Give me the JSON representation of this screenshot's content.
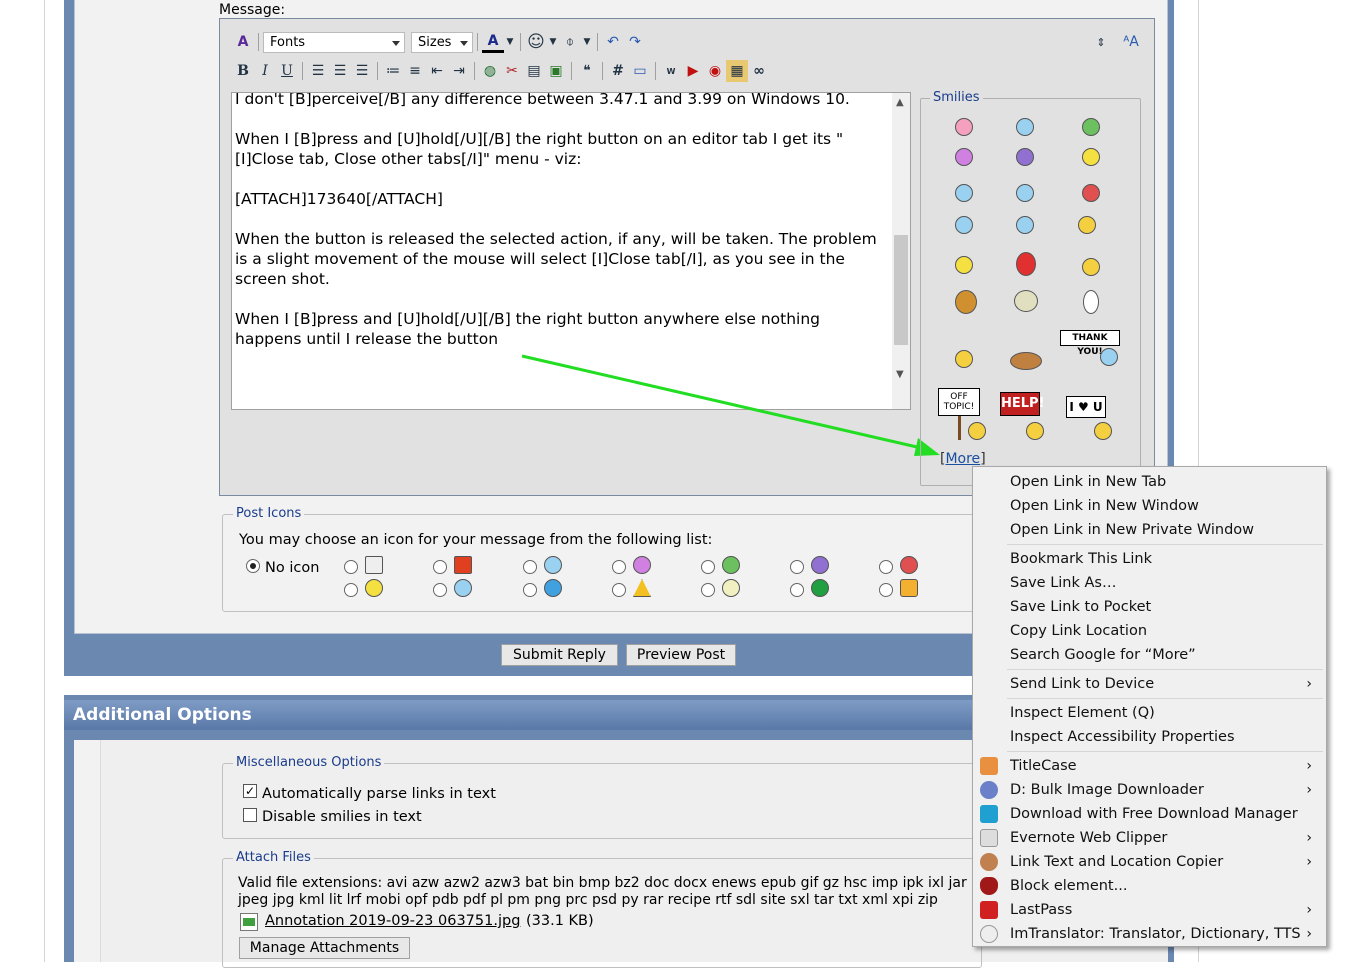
{
  "message_label": "Message:",
  "toolbar": {
    "fonts_label": "Fonts",
    "sizes_label": "Sizes"
  },
  "editor": {
    "text": "I don't [B]perceive[/B] any difference between 3.47.1 and 3.99 on Windows 10.\n\nWhen I [B]press and [U]hold[/U][/B] the right button on an editor tab I get its \"[I]Close tab, Close other tabs[/I]\" menu - viz:\n\n[ATTACH]173640[/ATTACH]\n\nWhen the button is released the selected action, if any, will be taken. The problem is a slight movement of the mouse will select [I]Close tab[/I], as you see in the screen shot.\n\nWhen I [B]press and [U]hold[/U][/B] the right button anywhere else nothing happens until I release the button"
  },
  "smilies": {
    "legend": "Smilies",
    "more_bracket_open": "[",
    "more_link": "More",
    "more_bracket_close": "]",
    "sign_off_topic": "OFF TOPIC!",
    "sign_help": "HELP!",
    "sign_thank_you": "THANK YOU!",
    "sign_i_love_u": "I ♥ U"
  },
  "post_icons": {
    "legend": "Post Icons",
    "instruction": "You may choose an icon for your message from the following list:",
    "no_icon_label": "No icon"
  },
  "buttons": {
    "submit": "Submit Reply",
    "preview": "Preview Post"
  },
  "additional": {
    "header": "Additional Options",
    "misc_legend": "Miscellaneous Options",
    "parse_links": "Automatically parse links in text",
    "disable_smilies": "Disable smilies in text",
    "attach_legend": "Attach Files",
    "extensions_line1": "Valid file extensions: avi azw azw2 azw3 bat bin bmp bz2 doc docx enews epub gif gz hsc imp ipk ixl jar",
    "extensions_line2": "jpeg jpg kml lit lrf mobi opf pdb pdf pl pm png prc psd py rar recipe rtf sdl site sxl tar txt xml xpi zip",
    "attachment_name": "Annotation 2019-09-23 063751.jpg",
    "attachment_size": "(33.1 KB)",
    "manage_button": "Manage Attachments"
  },
  "context_menu": {
    "items": [
      {
        "label": "Open Link in New Tab"
      },
      {
        "label": "Open Link in New Window"
      },
      {
        "label": "Open Link in New Private Window"
      },
      {
        "label": "Bookmark This Link"
      },
      {
        "label": "Save Link As…"
      },
      {
        "label": "Save Link to Pocket"
      },
      {
        "label": "Copy Link Location"
      },
      {
        "label": "Search Google for “More”"
      },
      {
        "label": "Send Link to Device"
      },
      {
        "label": "Inspect Element (Q)"
      },
      {
        "label": "Inspect Accessibility Properties"
      },
      {
        "label": "TitleCase"
      },
      {
        "label": "D: Bulk Image Downloader"
      },
      {
        "label": "Download with Free Download Manager"
      },
      {
        "label": "Evernote Web Clipper"
      },
      {
        "label": "Link Text and Location Copier"
      },
      {
        "label": "Block element..."
      },
      {
        "label": "LastPass"
      },
      {
        "label": "ImTranslator: Translator, Dictionary, TTS"
      }
    ],
    "submenu_arrow": "›"
  },
  "colors": {
    "accent_blue": "#6a88b0",
    "legend_blue": "#1a3c8c",
    "annotation_arrow": "#22dd22"
  }
}
